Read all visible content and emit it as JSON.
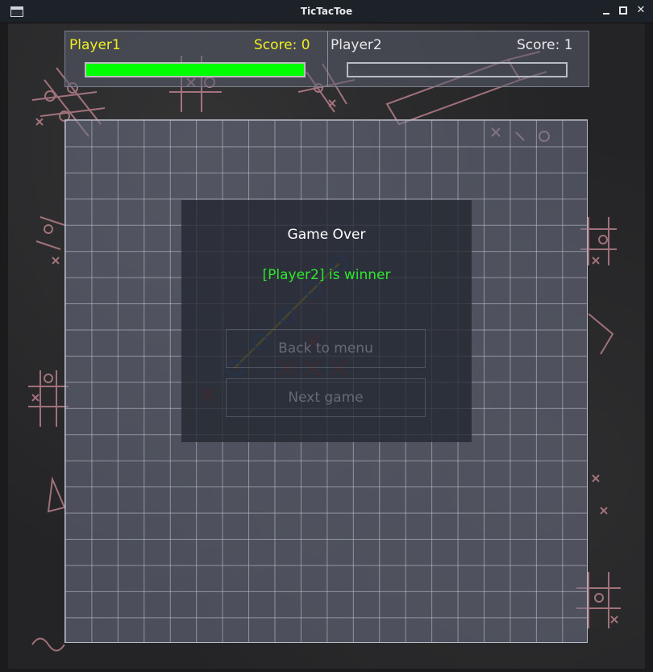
{
  "window": {
    "title": "TicTacToe"
  },
  "players": [
    {
      "name": "Player1",
      "score_text": "Score: 0",
      "name_color": "#f0ee22",
      "timer_fraction": 1.0,
      "timer_color": "#00ff00"
    },
    {
      "name": "Player2",
      "score_text": "Score: 1",
      "name_color": "#e8e8ea",
      "timer_fraction": 0.0,
      "timer_color": "#00ff00"
    }
  ],
  "board": {
    "rows": 20,
    "cols": 20,
    "marks": [
      {
        "type": "O",
        "col": 10,
        "row": 5
      },
      {
        "type": "O",
        "col": 9,
        "row": 6
      },
      {
        "type": "O",
        "col": 8,
        "row": 7
      },
      {
        "type": "O",
        "col": 7,
        "row": 8
      },
      {
        "type": "O",
        "col": 6,
        "row": 9
      },
      {
        "type": "X",
        "col": 9,
        "row": 8
      },
      {
        "type": "X",
        "col": 8,
        "row": 9
      },
      {
        "type": "X",
        "col": 9,
        "row": 9
      },
      {
        "type": "X",
        "col": 10,
        "row": 9
      },
      {
        "type": "X",
        "col": 5,
        "row": 10
      }
    ],
    "o_color": "#2f5fc8",
    "x_color": "#d02a2a",
    "win_line_color": "#b5b23a"
  },
  "dialog": {
    "title": "Game Over",
    "winner_text": "[Player2] is winner",
    "back_button": "Back to menu",
    "next_button": "Next game"
  }
}
